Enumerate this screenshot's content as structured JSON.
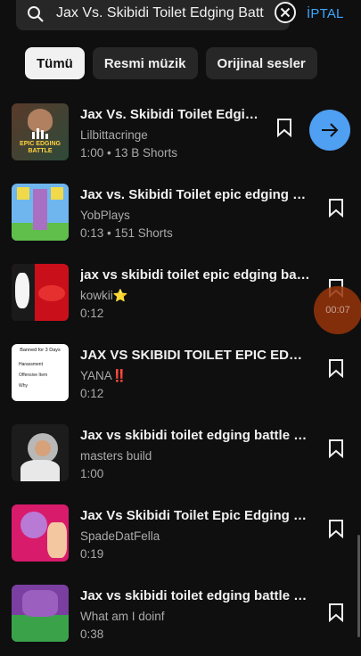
{
  "search": {
    "query": "Jax Vs. Skibidi Toilet Edging Battle",
    "cancel_label": "İPTAL"
  },
  "chips": [
    {
      "label": "Tümü",
      "active": true
    },
    {
      "label": "Resmi müzik",
      "active": false
    },
    {
      "label": "Orijinal sesler",
      "active": false
    }
  ],
  "results": [
    {
      "title": "Jax Vs. Skibidi Toilet Edging Battle",
      "channel": "Lilbittacringe",
      "meta": "1:00 • 13 B Shorts",
      "thumb_text": "EPIC EDGING BATTLE"
    },
    {
      "title": "Jax vs. Skibidi Toilet epic edging battle",
      "channel": "YobPlays",
      "meta": "0:13 • 151 Shorts"
    },
    {
      "title": "jax vs skibidi toilet epic edging battle",
      "channel": "kowkii⭐",
      "meta": "0:12"
    },
    {
      "title": "JAX VS SKIBIDI TOILET EPIC EDGING BATTLE",
      "channel": "YANA‼️",
      "meta": "0:12",
      "thumb_lines": [
        "Banned for 3 Days",
        "Harassment",
        "Offensive Item",
        "Why"
      ]
    },
    {
      "title": "Jax vs skibidi toilet edging battle (meme)",
      "channel": "masters build",
      "meta": "1:00"
    },
    {
      "title": "Jax Vs Skibidi Toilet Epic Edging Battle",
      "channel": "SpadeDatFella",
      "meta": "0:19"
    },
    {
      "title": "Jax vs skibidi toilet edging battle s...",
      "channel": "What am I doinf",
      "meta": "0:38"
    }
  ],
  "timer_overlay": "00:07",
  "colors": {
    "accent": "#3ea6ff",
    "background": "#0f0f0f",
    "chip": "#272727"
  }
}
